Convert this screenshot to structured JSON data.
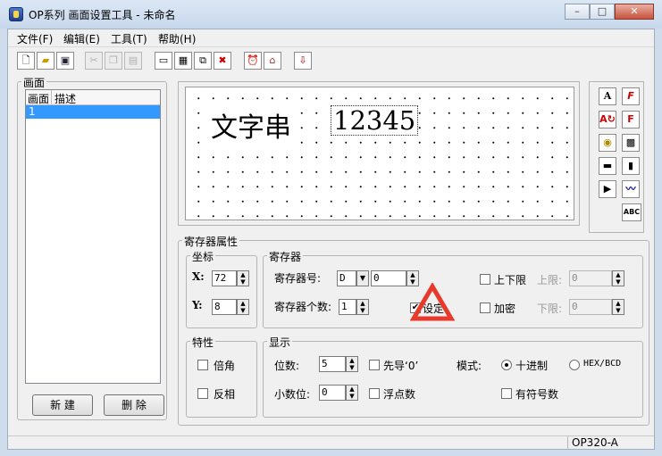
{
  "window": {
    "title": "OP系列 画面设置工具 - 未命名",
    "min": "–",
    "max": "□",
    "close": "✕"
  },
  "menu": [
    "文件(F)",
    "编辑(E)",
    "工具(T)",
    "帮助(H)"
  ],
  "toolbar_icons": [
    "new-icon",
    "open-icon",
    "save-icon",
    "cut-icon",
    "copy-icon",
    "paste-icon",
    "screen-icon",
    "screen-settings-icon",
    "copy-screen-icon",
    "delete-screen-icon",
    "alarm-clock-icon",
    "home-icon",
    "download-icon"
  ],
  "screens_panel": {
    "label": "画面",
    "columns": [
      "画面",
      "描述"
    ],
    "rows": [
      {
        "screen": "1",
        "desc": ""
      }
    ],
    "new_button": "新  建",
    "delete_button": "删  除"
  },
  "canvas": {
    "static_text": "文字串",
    "number_display": "12345"
  },
  "palette": [
    "A",
    "F",
    "",
    "F",
    "",
    "",
    "",
    "",
    "",
    "",
    "ABC"
  ],
  "register_props": {
    "label": "寄存器属性",
    "coords": {
      "label": "坐标",
      "x_label": "X:",
      "x_value": "72",
      "y_label": "Y:",
      "y_value": "8"
    },
    "register": {
      "label": "寄存器",
      "reg_no_label": "寄存器号:",
      "reg_type": "D",
      "reg_no": "0",
      "reg_count_label": "寄存器个数:",
      "reg_count": "1",
      "limit_label": "上下限",
      "upper_label": "上限:",
      "upper_value": "0",
      "lower_label": "下限:",
      "lower_value": "0",
      "set_label": "设定",
      "encrypt_label": "加密"
    },
    "traits": {
      "label": "特性",
      "double_label": "倍角",
      "inverse_label": "反相"
    },
    "display": {
      "label": "显示",
      "digits_label": "位数:",
      "digits": "5",
      "leading_zero_label": "先导‘0’",
      "decimals_label": "小数位:",
      "decimals": "0",
      "float_label": "浮点数",
      "mode_label": "模式:",
      "decimal_label": "十进制",
      "hexbcd_label": "HEX/BCD",
      "signed_label": "有符号数"
    }
  },
  "status": {
    "model": "OP320-A"
  },
  "colors": {
    "selection": "#3399ff",
    "warning": "#e8392a"
  }
}
